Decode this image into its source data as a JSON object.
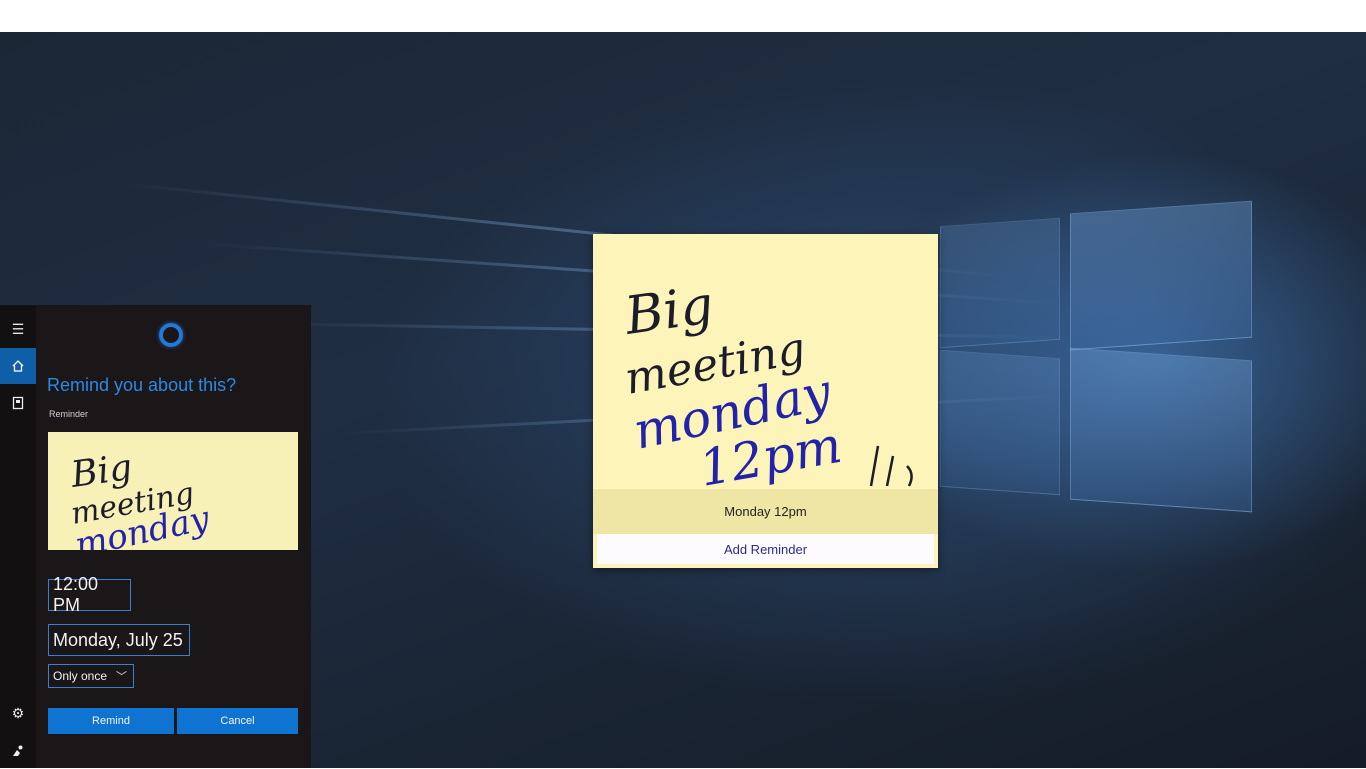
{
  "sticky_note": {
    "ink_lines": [
      "Big",
      "meeting",
      "monday",
      "12pm"
    ],
    "suggestion": "Monday 12pm",
    "add_reminder_label": "Add Reminder"
  },
  "cortana": {
    "prompt_title": "Remind you about this?",
    "reminder_label": "Reminder",
    "thumbnail_ink_lines": [
      "Big",
      "meeting",
      "monday"
    ],
    "time_value": "12:00 PM",
    "date_value": "Monday, July 25",
    "repeat_value": "Only once",
    "remind_label": "Remind",
    "cancel_label": "Cancel"
  },
  "rail": {
    "icons": [
      "menu-icon",
      "home-icon",
      "notebook-icon",
      "settings-icon",
      "feedback-icon"
    ]
  },
  "colors": {
    "accent": "#0f74d1",
    "sticky_yellow": "#fcf4b8",
    "panel_bg": "#1b1617",
    "desktop_bg": "#1f2e43"
  }
}
